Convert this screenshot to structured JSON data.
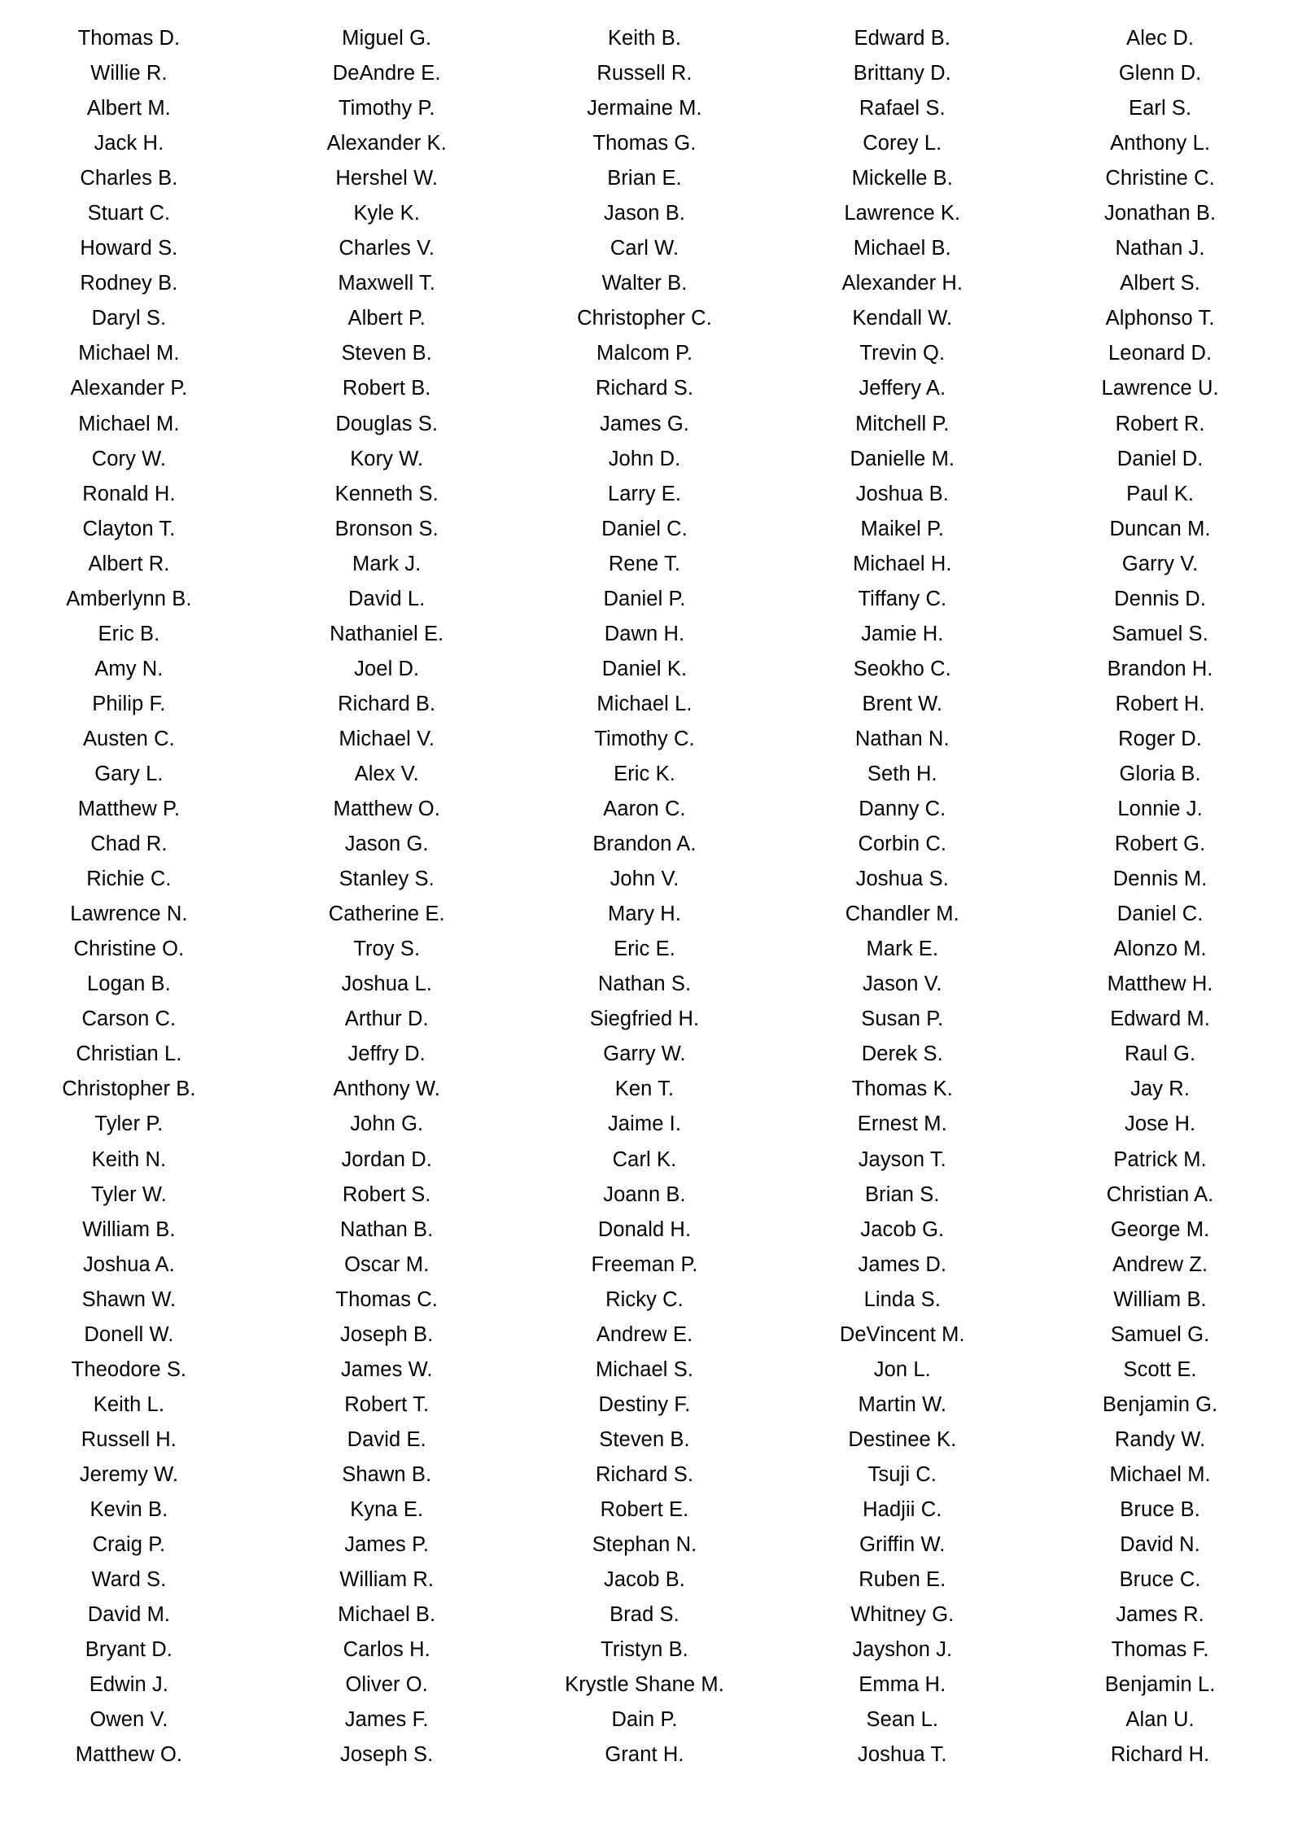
{
  "document": {
    "background_color": "#ffffff",
    "text_color": "#000000",
    "column_count": 5,
    "row_count": 50,
    "layout": "five-column-centered-name-list"
  },
  "columns": [
    {
      "index": 1,
      "name": "names-column-1",
      "entries": [
        "Thomas D.",
        "Willie R.",
        "Albert M.",
        "Jack H.",
        "Charles B.",
        "Stuart C.",
        "Howard S.",
        "Rodney B.",
        "Daryl S.",
        "Michael M.",
        "Alexander P.",
        "Michael M.",
        "Cory W.",
        "Ronald H.",
        "Clayton T.",
        "Albert R.",
        "Amberlynn B.",
        "Eric B.",
        "Amy N.",
        "Philip F.",
        "Austen C.",
        "Gary L.",
        "Matthew P.",
        "Chad R.",
        "Richie C.",
        "Lawrence N.",
        "Christine O.",
        "Logan B.",
        "Carson C.",
        "Christian L.",
        "Christopher B.",
        "Tyler P.",
        "Keith N.",
        "Tyler W.",
        "William B.",
        "Joshua A.",
        "Shawn W.",
        "Donell W.",
        "Theodore S.",
        "Keith L.",
        "Russell H.",
        "Jeremy W.",
        "Kevin B.",
        "Craig P.",
        "Ward S.",
        "David M.",
        "Bryant D.",
        "Edwin J.",
        "Owen V.",
        "Matthew O."
      ]
    },
    {
      "index": 2,
      "name": "names-column-2",
      "entries": [
        "Miguel G.",
        "DeAndre E.",
        "Timothy P.",
        "Alexander K.",
        "Hershel W.",
        "Kyle K.",
        "Charles V.",
        "Maxwell T.",
        "Albert P.",
        "Steven B.",
        "Robert B.",
        "Douglas S.",
        "Kory W.",
        "Kenneth S.",
        "Bronson S.",
        "Mark J.",
        "David L.",
        "Nathaniel E.",
        "Joel D.",
        "Richard B.",
        "Michael V.",
        "Alex V.",
        "Matthew O.",
        "Jason G.",
        "Stanley S.",
        "Catherine E.",
        "Troy S.",
        "Joshua L.",
        "Arthur D.",
        "Jeffry D.",
        "Anthony W.",
        "John G.",
        "Jordan D.",
        "Robert S.",
        "Nathan B.",
        "Oscar M.",
        "Thomas C.",
        "Joseph B.",
        "James W.",
        "Robert T.",
        "David E.",
        "Shawn B.",
        "Kyna E.",
        "James P.",
        "William R.",
        "Michael B.",
        "Carlos H.",
        "Oliver O.",
        "James F.",
        "Joseph S."
      ]
    },
    {
      "index": 3,
      "name": "names-column-3",
      "entries": [
        "Keith B.",
        "Russell R.",
        "Jermaine M.",
        "Thomas G.",
        "Brian E.",
        "Jason B.",
        "Carl W.",
        "Walter B.",
        "Christopher C.",
        "Malcom P.",
        "Richard S.",
        "James G.",
        "John D.",
        "Larry E.",
        "Daniel C.",
        "Rene T.",
        "Daniel P.",
        "Dawn H.",
        "Daniel K.",
        "Michael L.",
        "Timothy C.",
        "Eric K.",
        "Aaron C.",
        "Brandon A.",
        "John V.",
        "Mary H.",
        "Eric E.",
        "Nathan S.",
        "Siegfried H.",
        "Garry W.",
        "Ken T.",
        "Jaime I.",
        "Carl K.",
        "Joann B.",
        "Donald H.",
        "Freeman P.",
        "Ricky C.",
        "Andrew E.",
        "Michael S.",
        "Destiny F.",
        "Steven B.",
        "Richard S.",
        "Robert E.",
        "Stephan N.",
        "Jacob B.",
        "Brad S.",
        "Tristyn B.",
        "Krystle Shane M.",
        "Dain P.",
        "Grant H."
      ]
    },
    {
      "index": 4,
      "name": "names-column-4",
      "entries": [
        "Edward B.",
        "Brittany D.",
        "Rafael S.",
        "Corey L.",
        "Mickelle B.",
        "Lawrence K.",
        "Michael B.",
        "Alexander H.",
        "Kendall W.",
        "Trevin Q.",
        "Jeffery A.",
        "Mitchell P.",
        "Danielle M.",
        "Joshua B.",
        "Maikel P.",
        "Michael H.",
        "Tiffany C.",
        "Jamie H.",
        "Seokho C.",
        "Brent W.",
        "Nathan N.",
        "Seth H.",
        "Danny C.",
        "Corbin C.",
        "Joshua S.",
        "Chandler M.",
        "Mark E.",
        "Jason V.",
        "Susan P.",
        "Derek S.",
        "Thomas K.",
        "Ernest M.",
        "Jayson T.",
        "Brian S.",
        "Jacob G.",
        "James D.",
        "Linda S.",
        "DeVincent M.",
        "Jon L.",
        "Martin W.",
        "Destinee K.",
        "Tsuji C.",
        "Hadjii C.",
        "Griffin W.",
        "Ruben E.",
        "Whitney G.",
        "Jayshon J.",
        "Emma H.",
        "Sean L.",
        "Joshua T."
      ]
    },
    {
      "index": 5,
      "name": "names-column-5",
      "entries": [
        "Alec D.",
        "Glenn D.",
        "Earl S.",
        "Anthony L.",
        "Christine C.",
        "Jonathan B.",
        "Nathan J.",
        "Albert S.",
        "Alphonso T.",
        "Leonard D.",
        "Lawrence U.",
        "Robert R.",
        "Daniel D.",
        "Paul K.",
        "Duncan M.",
        "Garry V.",
        "Dennis D.",
        "Samuel S.",
        "Brandon H.",
        "Robert H.",
        "Roger D.",
        "Gloria B.",
        "Lonnie J.",
        "Robert G.",
        "Dennis M.",
        "Daniel C.",
        "Alonzo M.",
        "Matthew H.",
        "Edward M.",
        "Raul G.",
        "Jay R.",
        "Jose H.",
        "Patrick M.",
        "Christian A.",
        "George M.",
        "Andrew Z.",
        "William B.",
        "Samuel G.",
        "Scott E.",
        "Benjamin G.",
        "Randy W.",
        "Michael M.",
        "Bruce B.",
        "David N.",
        "Bruce C.",
        "James R.",
        "Thomas F.",
        "Benjamin L.",
        "Alan U.",
        "Richard H."
      ]
    }
  ]
}
